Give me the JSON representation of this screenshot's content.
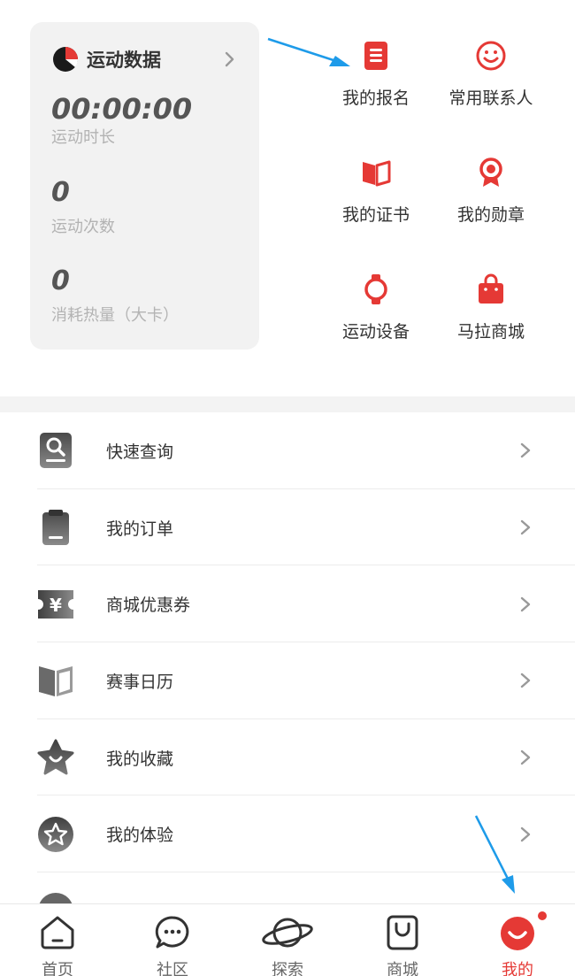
{
  "stats": {
    "title": "运动数据",
    "duration_value": "00:00:00",
    "duration_label": "运动时长",
    "count_value": "0",
    "count_label": "运动次数",
    "calories_value": "0",
    "calories_label": "消耗热量（大卡）"
  },
  "quick": [
    {
      "label": "我的报名",
      "icon": "document-icon"
    },
    {
      "label": "常用联系人",
      "icon": "smiley-icon"
    },
    {
      "label": "我的证书",
      "icon": "certificate-book-icon"
    },
    {
      "label": "我的勋章",
      "icon": "medal-icon"
    },
    {
      "label": "运动设备",
      "icon": "watch-icon"
    },
    {
      "label": "马拉商城",
      "icon": "shopping-bag-icon"
    }
  ],
  "menu": [
    {
      "label": "快速查询",
      "icon": "search-card-icon"
    },
    {
      "label": "我的订单",
      "icon": "clipboard-icon"
    },
    {
      "label": "商城优惠券",
      "icon": "coupon-yen-icon"
    },
    {
      "label": "赛事日历",
      "icon": "book-icon"
    },
    {
      "label": "我的收藏",
      "icon": "star-icon"
    },
    {
      "label": "我的体验",
      "icon": "star-circle-icon"
    }
  ],
  "nav": [
    {
      "label": "首页",
      "icon": "home-icon"
    },
    {
      "label": "社区",
      "icon": "chat-bubble-icon"
    },
    {
      "label": "探索",
      "icon": "planet-icon"
    },
    {
      "label": "商城",
      "icon": "bag-icon"
    },
    {
      "label": "我的",
      "icon": "smile-profile-icon",
      "active": true
    }
  ],
  "colors": {
    "accent": "#e53935",
    "annotation_arrow": "#1e9be9"
  }
}
